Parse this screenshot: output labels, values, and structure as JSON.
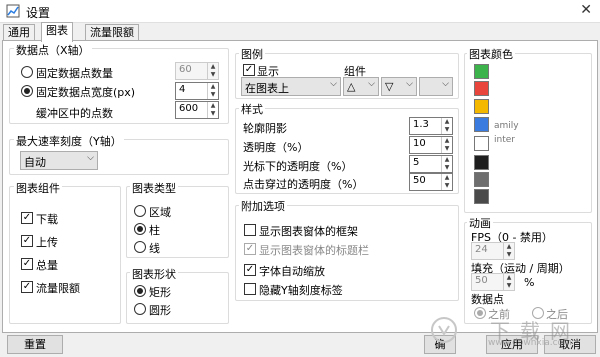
{
  "window": {
    "title": "设置",
    "close_glyph": "✕"
  },
  "tabs": [
    "通用",
    "图表",
    "流量限额"
  ],
  "data_points": {
    "label": "数据点（X轴）",
    "fixed_count_label": "固定数据点数量",
    "fixed_count_value": "60",
    "fixed_width_label": "固定数据点宽度(px)",
    "fixed_width_value": "4",
    "buffer_label": "缓冲区中的点数",
    "buffer_value": "600"
  },
  "max_rate": {
    "label": "最大速率刻度（Y轴）",
    "value": "自动"
  },
  "chart_components": {
    "label": "图表组件",
    "items": [
      "下载",
      "上传",
      "总量",
      "流量限额"
    ]
  },
  "chart_type": {
    "label": "图表类型",
    "items": [
      "区域",
      "柱",
      "线"
    ]
  },
  "chart_shape": {
    "label": "图表形状",
    "items": [
      "矩形",
      "圆形"
    ]
  },
  "legend": {
    "label": "图例",
    "show_label": "显示",
    "group_label": "组件",
    "position_value": "在图表上"
  },
  "style": {
    "label": "样式",
    "rows": [
      {
        "label": "轮廓阴影",
        "value": "1.3"
      },
      {
        "label": "透明度（%）",
        "value": "10"
      },
      {
        "label": "光标下的透明度（%）",
        "value": "5"
      },
      {
        "label": "点击穿过的透明度（%）",
        "value": "50"
      }
    ]
  },
  "extra": {
    "label": "附加选项",
    "items": [
      "显示图表窗体的框架",
      "显示图表窗体的标题栏",
      "字体自动缩放",
      "隐藏Y轴刻度标签"
    ]
  },
  "colors": {
    "label": "图表颜色",
    "swatches": [
      "#3cb44b",
      "#e8453c",
      "#f5b800",
      "#3a7be0",
      "#ffffff",
      "#1e1e1e",
      "#6e6e6e",
      "#4a4a4a"
    ],
    "overlay_texts": [
      "amily",
      "inter"
    ]
  },
  "animation": {
    "label": "动画",
    "fps_label": "FPS（0 - 禁用）",
    "fps_value": "24",
    "fill_label": "填充（运动 / 周期）",
    "fill_value": "50",
    "fill_unit": "%",
    "points_label": "数据点",
    "before_label": "之前",
    "after_label": "之后"
  },
  "buttons": {
    "reset": "重置",
    "ok": "确",
    "apply": "应用",
    "cancel": "取消"
  },
  "watermark": {
    "text": "下载网",
    "url": "www.downxia.com"
  }
}
